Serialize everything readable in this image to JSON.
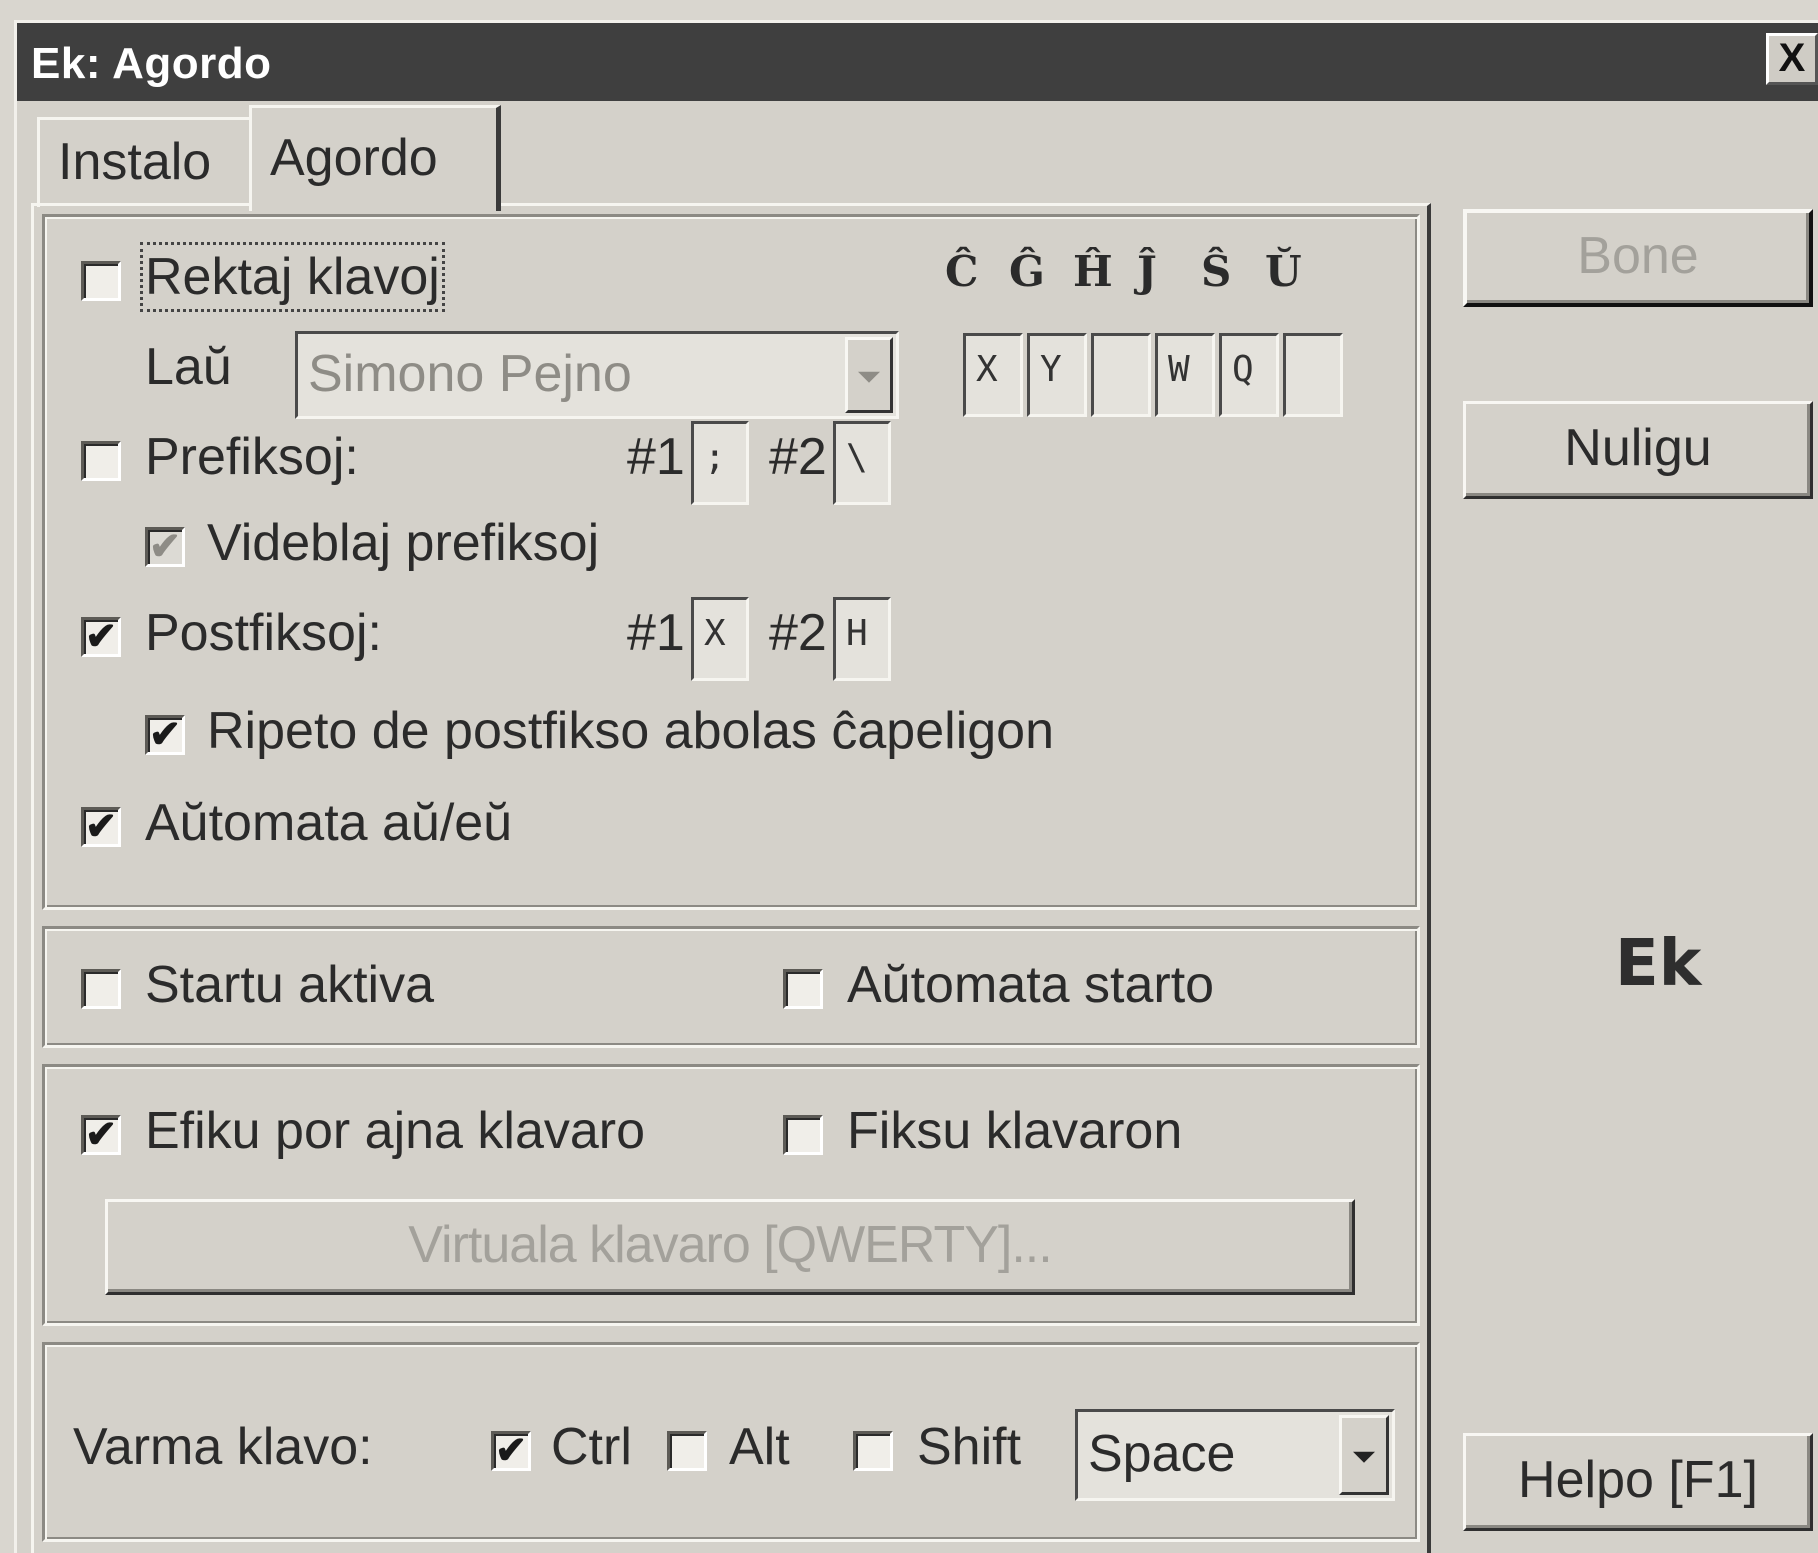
{
  "window": {
    "title": "Ek: Agordo",
    "close_label": "X"
  },
  "tabs": [
    {
      "label": "Instalo"
    },
    {
      "label": "Agordo"
    }
  ],
  "group1": {
    "rektaj_klavoj": {
      "label": "Rektaj klavoj",
      "checked": false
    },
    "accent_letters": [
      "Ĉ",
      "Ĝ",
      "Ĥ",
      "Ĵ",
      "Ŝ",
      "Ŭ"
    ],
    "lau_label": "Laŭ",
    "layout_select": {
      "value": "Simono Pejno"
    },
    "key_fields": [
      "X",
      "Y",
      "",
      "W",
      "Q",
      ""
    ],
    "prefiksoj": {
      "label": "Prefiksoj:",
      "checked": false,
      "n1_label": "#1",
      "n1_value": ";",
      "n2_label": "#2",
      "n2_value": "\\"
    },
    "videblaj_prefiksoj": {
      "label": "Videblaj prefiksoj",
      "checked": true
    },
    "postfiksoj": {
      "label": "Postfiksoj:",
      "checked": true,
      "n1_label": "#1",
      "n1_value": "X",
      "n2_label": "#2",
      "n2_value": "H"
    },
    "ripeto": {
      "label": "Ripeto de postfikso abolas ĉapeligon",
      "checked": true
    },
    "automata_au": {
      "label": "Aŭtomata aŭ/eŭ",
      "checked": true
    }
  },
  "group2": {
    "startu_aktiva": {
      "label": "Startu aktiva",
      "checked": false
    },
    "automata_starto": {
      "label": "Aŭtomata starto",
      "checked": false
    }
  },
  "group3": {
    "efiku": {
      "label": "Efiku por ajna klavaro",
      "checked": true
    },
    "fiksu": {
      "label": "Fiksu klavaron",
      "checked": false
    },
    "virtual_button": "Virtuala klavaro [QWERTY]..."
  },
  "group4": {
    "varma_label": "Varma klavo:",
    "ctrl": {
      "label": "Ctrl",
      "checked": true
    },
    "alt": {
      "label": "Alt",
      "checked": false
    },
    "shift": {
      "label": "Shift",
      "checked": false
    },
    "key_select": {
      "value": "Space"
    }
  },
  "side": {
    "bone": "Bone",
    "nuligu": "Nuligu",
    "logo": "Ek",
    "helpo": "Helpo [F1]"
  },
  "check_glyph": "✔"
}
